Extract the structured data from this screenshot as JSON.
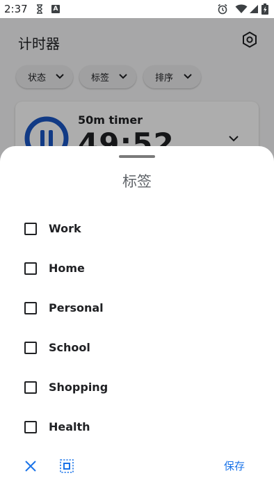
{
  "status_bar": {
    "time": "2:37",
    "left_icons": [
      "hourglass-icon",
      "app-notification-a-icon"
    ],
    "right_icons": [
      "alarm-icon",
      "wifi-icon",
      "signal-icon",
      "battery-charging-icon"
    ],
    "a_icon_text": "A"
  },
  "app": {
    "title": "计时器",
    "filters": [
      {
        "label": "状态"
      },
      {
        "label": "标签"
      },
      {
        "label": "排序"
      }
    ],
    "timer": {
      "name": "50m timer",
      "remaining": "49:52",
      "state_icon": "pause-icon",
      "accent_color": "#1a56c4"
    }
  },
  "sheet": {
    "title": "标签",
    "tags": [
      {
        "label": "Work",
        "checked": false
      },
      {
        "label": "Home",
        "checked": false
      },
      {
        "label": "Personal",
        "checked": false
      },
      {
        "label": "School",
        "checked": false
      },
      {
        "label": "Shopping",
        "checked": false
      },
      {
        "label": "Health",
        "checked": false
      }
    ],
    "actions": {
      "close_icon": "close-icon",
      "select_all_icon": "select-all-icon",
      "save_label": "保存",
      "accent_color": "#1a73e8"
    }
  }
}
